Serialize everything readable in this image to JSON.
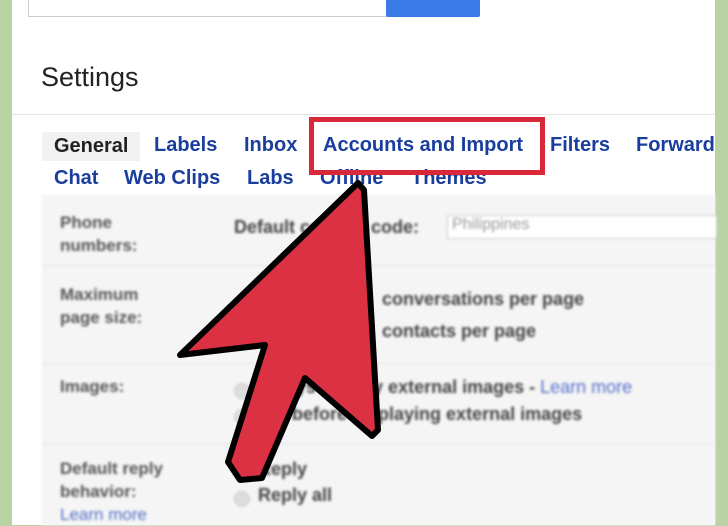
{
  "header": {
    "title": "Settings"
  },
  "tabs_row1": [
    "General",
    "Labels",
    "Inbox",
    "Accounts and Import",
    "Filters",
    "Forward"
  ],
  "tabs_row2": [
    "Chat",
    "Web Clips",
    "Labs",
    "Offline",
    "Themes"
  ],
  "settings": {
    "phone": {
      "label": "Phone numbers:",
      "field_label": "Default country code:",
      "value": "Philippines"
    },
    "page_size": {
      "label": "Maximum page size:",
      "opt1": "conversations per page",
      "opt2": "contacts per page"
    },
    "images": {
      "label": "Images:",
      "opt1": "Always display external images",
      "learn_more": "Learn more",
      "opt2": "Ask before displaying external images"
    },
    "reply": {
      "label": "Default reply behavior:",
      "learn_more": "Learn more",
      "opt1": "Reply",
      "opt2": "Reply all"
    }
  },
  "colors": {
    "highlight": "#d8283a",
    "arrow": "#dc3043",
    "link": "#1a3e9e",
    "border": "#b9d3a4"
  }
}
